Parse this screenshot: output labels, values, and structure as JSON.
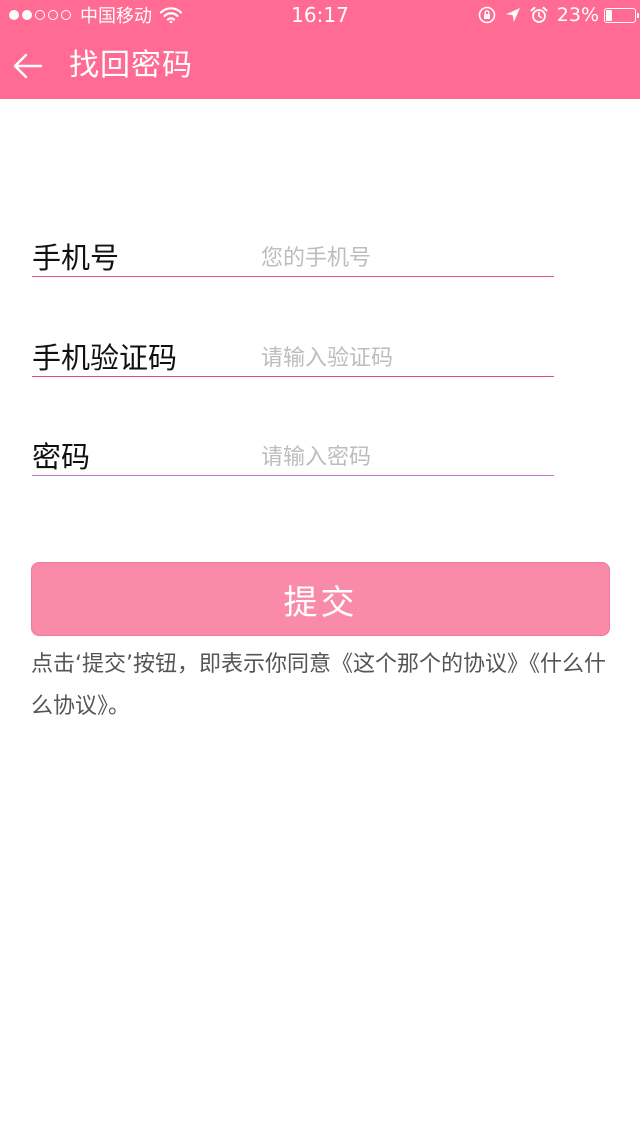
{
  "status_bar": {
    "carrier": "中国移动",
    "time": "16:17",
    "battery_percent": "23%",
    "battery_level": 0.23,
    "signal_strength_dots": 2,
    "icons": [
      "signal-dots-icon",
      "wifi-icon",
      "rotation-lock-icon",
      "location-arrow-icon",
      "alarm-icon",
      "battery-icon"
    ]
  },
  "nav": {
    "back_icon": "arrow-left-icon",
    "title": "找回密码"
  },
  "form": {
    "phone": {
      "label": "手机号",
      "placeholder": "您的手机号"
    },
    "code": {
      "label": "手机验证码",
      "placeholder": "请输入验证码"
    },
    "password": {
      "label": "密码",
      "placeholder": "请输入密码"
    }
  },
  "submit": {
    "label": "提交"
  },
  "agreement": {
    "text": "点击‘提交’按钮，即表示你同意《这个那个的协议》《什么什么协议》。"
  },
  "colors": {
    "header": "#ff6b92",
    "button": "#f98aa8",
    "underline_phone": "#e0587d",
    "underline_code": "#d9507f",
    "underline_password": "#c978c8"
  }
}
